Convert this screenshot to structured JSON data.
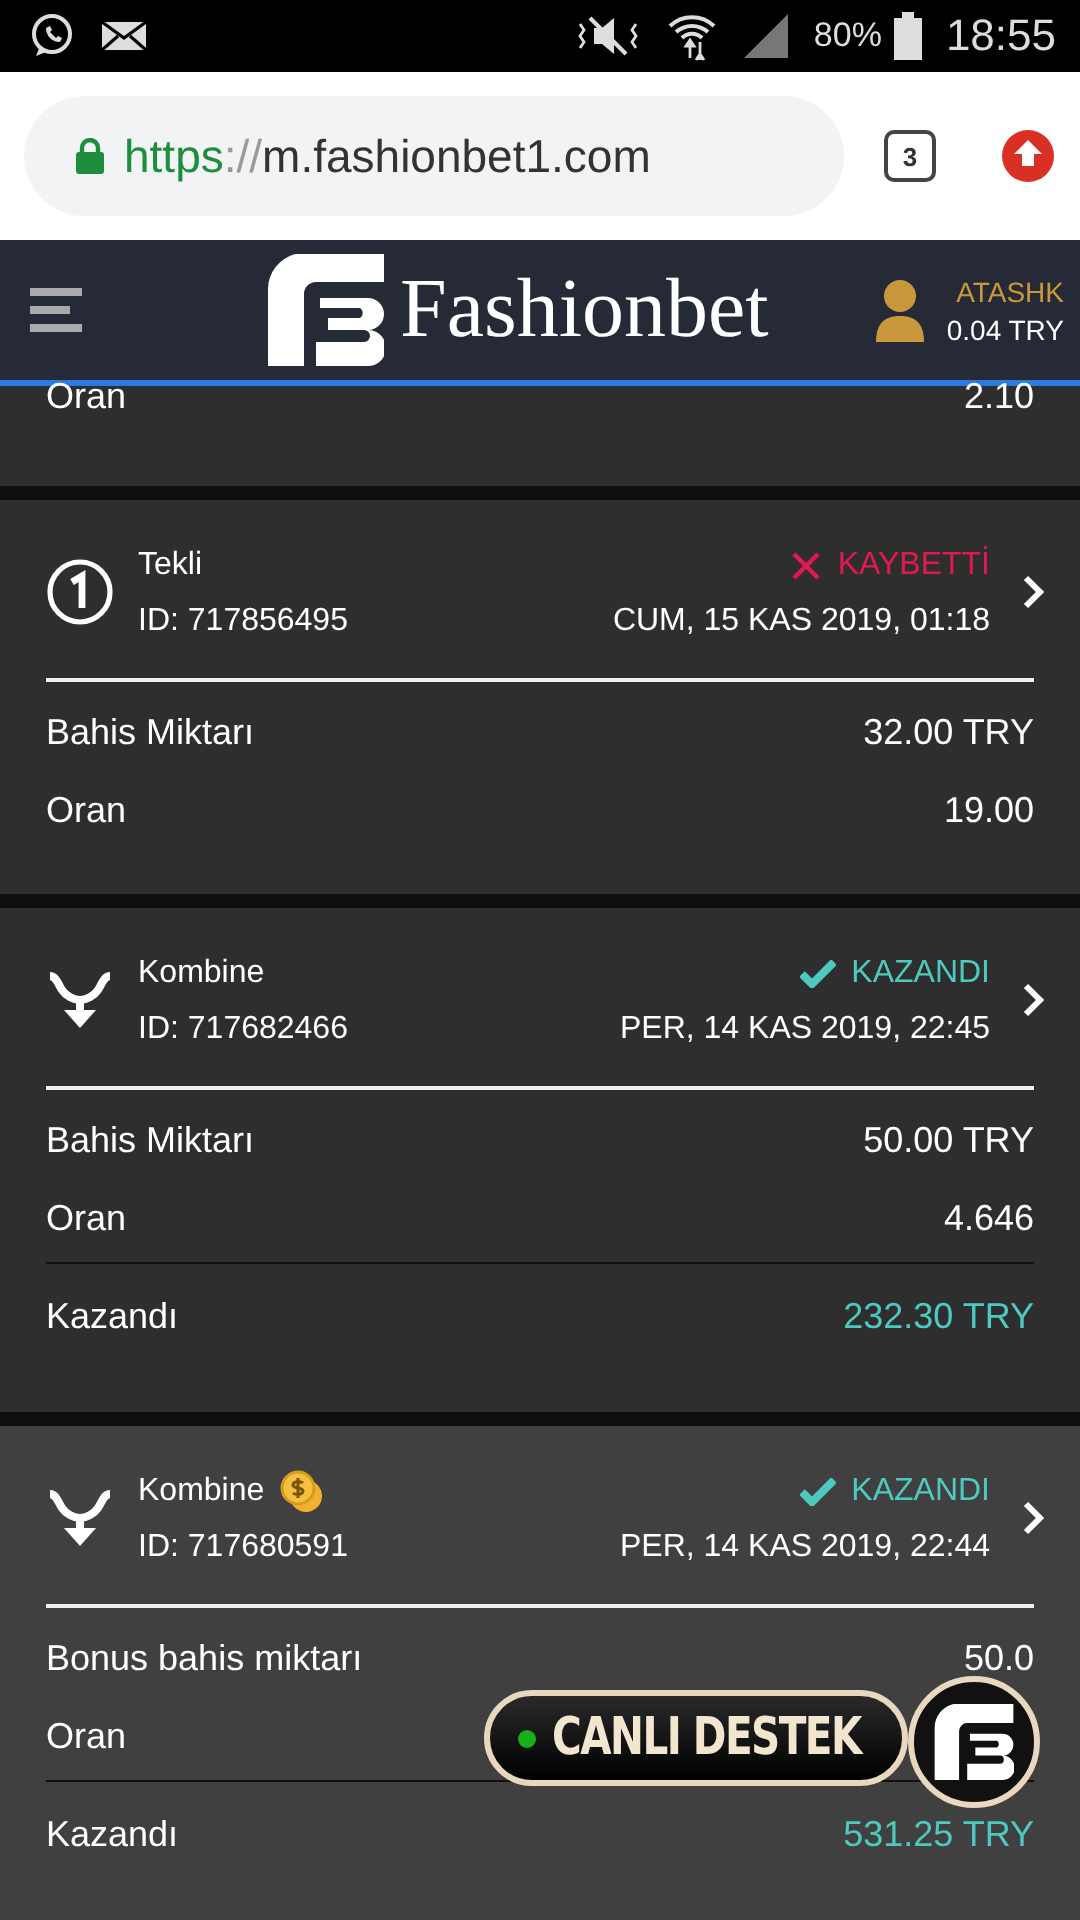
{
  "status_bar": {
    "battery": "80%",
    "time": "18:55"
  },
  "browser": {
    "url_scheme": "https",
    "url_sep": "://",
    "url_host": "m.fashionbet1.com",
    "tab_count": "3"
  },
  "header": {
    "brand": "Fashionbet",
    "username": "ATASHK",
    "balance": "0.04 TRY"
  },
  "bets": [
    {
      "partial": true,
      "selected": false,
      "rows": [
        {
          "label": "Oran",
          "value": "2.10",
          "kind": "plain"
        }
      ]
    },
    {
      "partial": false,
      "selected": false,
      "kind": "single",
      "title": "Tekli",
      "bonus": false,
      "id": "ID: 717856495",
      "won": false,
      "result_label": "KAYBETTİ",
      "date": "CUM, 15 KAS 2019, 01:18",
      "rows": [
        {
          "label": "Bahis Miktarı",
          "value": "32.00 TRY",
          "kind": "plain"
        },
        {
          "label": "Oran",
          "value": "19.00",
          "kind": "plain"
        }
      ]
    },
    {
      "partial": false,
      "selected": false,
      "kind": "combo",
      "title": "Kombine",
      "bonus": false,
      "id": "ID: 717682466",
      "won": true,
      "result_label": "KAZANDI",
      "date": "PER, 14 KAS 2019, 22:45",
      "rows": [
        {
          "label": "Bahis Miktarı",
          "value": "50.00 TRY",
          "kind": "plain"
        },
        {
          "label": "Oran",
          "value": "4.646",
          "kind": "plain"
        },
        {
          "label": "Kazandı",
          "value": "232.30 TRY",
          "kind": "payout"
        }
      ]
    },
    {
      "partial": false,
      "selected": true,
      "kind": "combo",
      "title": "Kombine",
      "bonus": true,
      "id": "ID: 717680591",
      "won": true,
      "result_label": "KAZANDI",
      "date": "PER, 14 KAS 2019, 22:44",
      "rows": [
        {
          "label": "Bonus bahis miktarı",
          "value": "50.0",
          "kind": "plain"
        },
        {
          "label": "Oran",
          "kind": "plain"
        },
        {
          "label": "Kazandı",
          "value": "531.25 TRY",
          "kind": "payout"
        }
      ]
    }
  ],
  "live_support": {
    "label": "CANLI DESTEK",
    "online": true
  }
}
